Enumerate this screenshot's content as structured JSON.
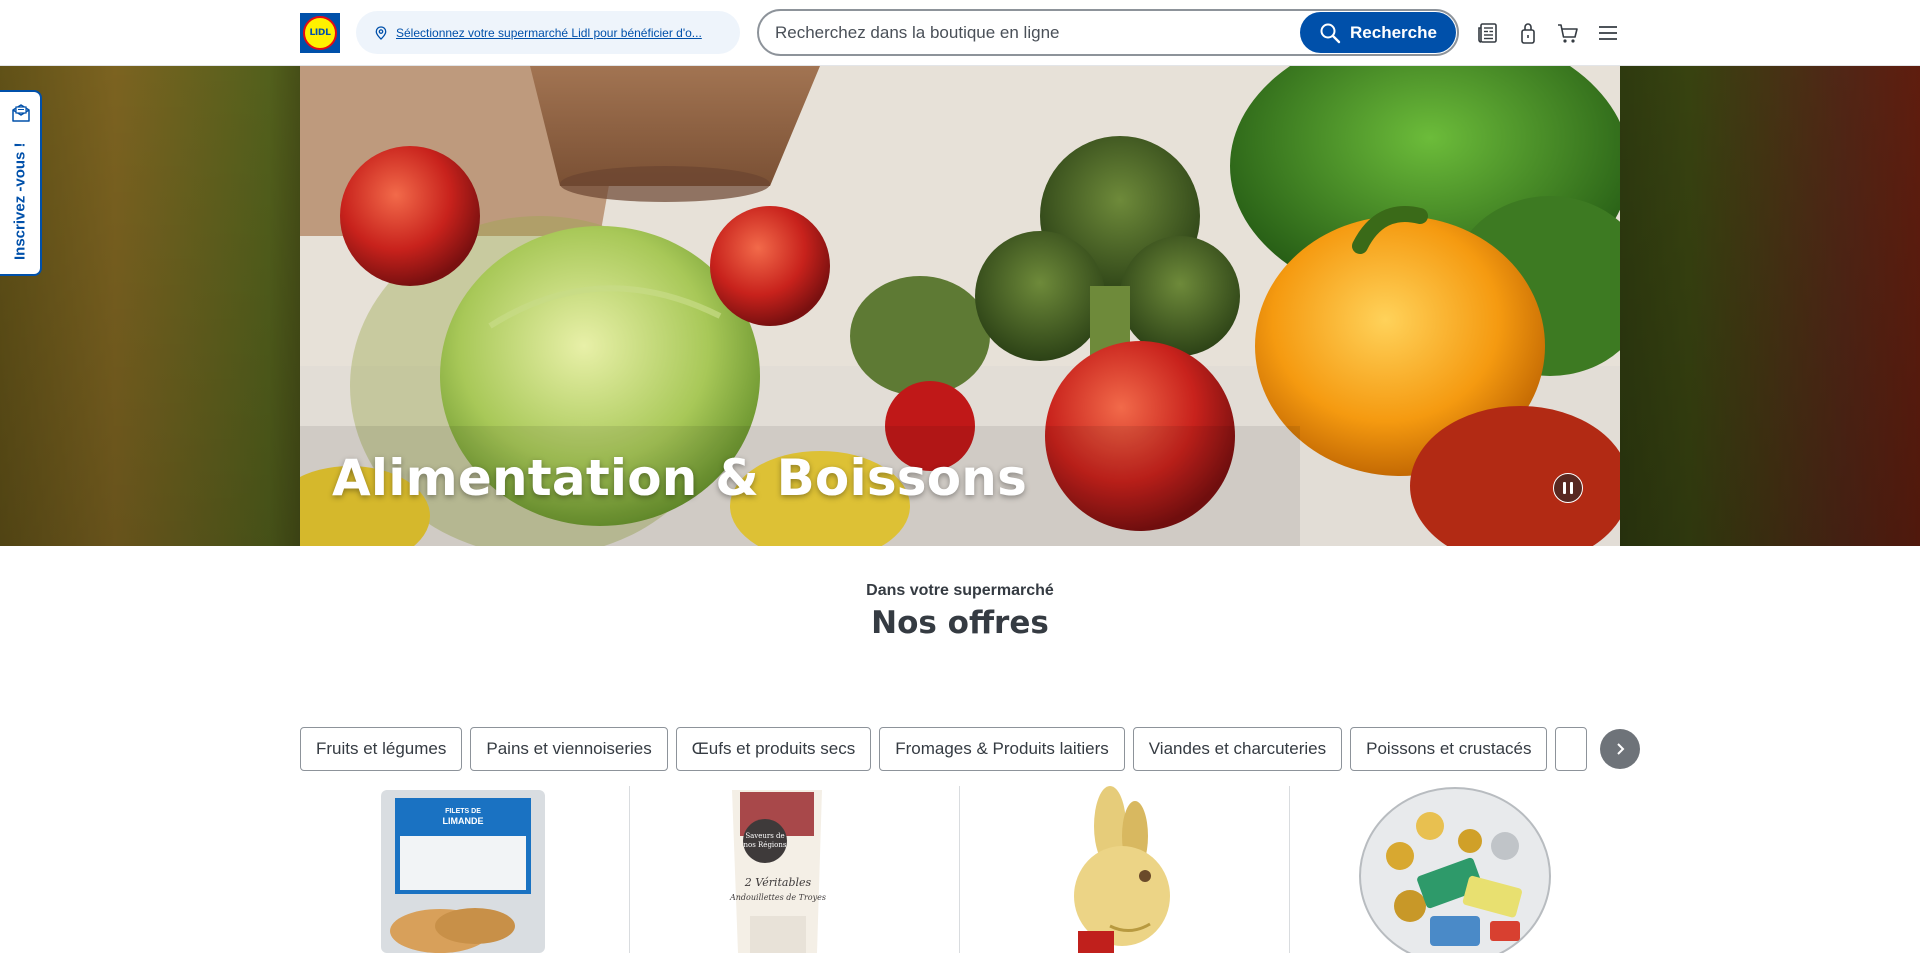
{
  "header": {
    "logo_text": "LIDL",
    "store_selector": "Sélectionnez votre supermarché Lidl pour bénéficier d'o...",
    "search_placeholder": "Recherchez dans la boutique en ligne",
    "search_button": "Recherche",
    "icons": [
      "leaflet-icon",
      "account-icon",
      "cart-icon",
      "menu-icon"
    ]
  },
  "side_tab": {
    "label": "Inscrivez -vous !",
    "icon": "newsletter-mail-icon"
  },
  "hero": {
    "title": "Alimentation & Boissons",
    "pause_icon": "pause-icon"
  },
  "section": {
    "eyebrow": "Dans votre supermarché",
    "title": "Nos offres"
  },
  "categories": [
    "Fruits et légumes",
    "Pains et viennoiseries",
    "Œufs et produits secs",
    "Fromages & Produits laitiers",
    "Viandes et charcuteries",
    "Poissons et crustacés"
  ],
  "products": [
    {
      "name": "filets-de-limande",
      "label_line1": "FILETS DE",
      "label_line2": "LIMANDE"
    },
    {
      "name": "andouillettes",
      "label_line1": "Saveurs de",
      "label_line2": "nos Régions",
      "label_line3": "2 Véritables",
      "label_line4": "Andouillettes de Troyes"
    },
    {
      "name": "chocolate-bunny"
    },
    {
      "name": "chocolate-coins-net"
    }
  ],
  "colors": {
    "brand_blue": "#0050aa",
    "brand_yellow": "#fff100",
    "brand_red": "#e60a14"
  }
}
